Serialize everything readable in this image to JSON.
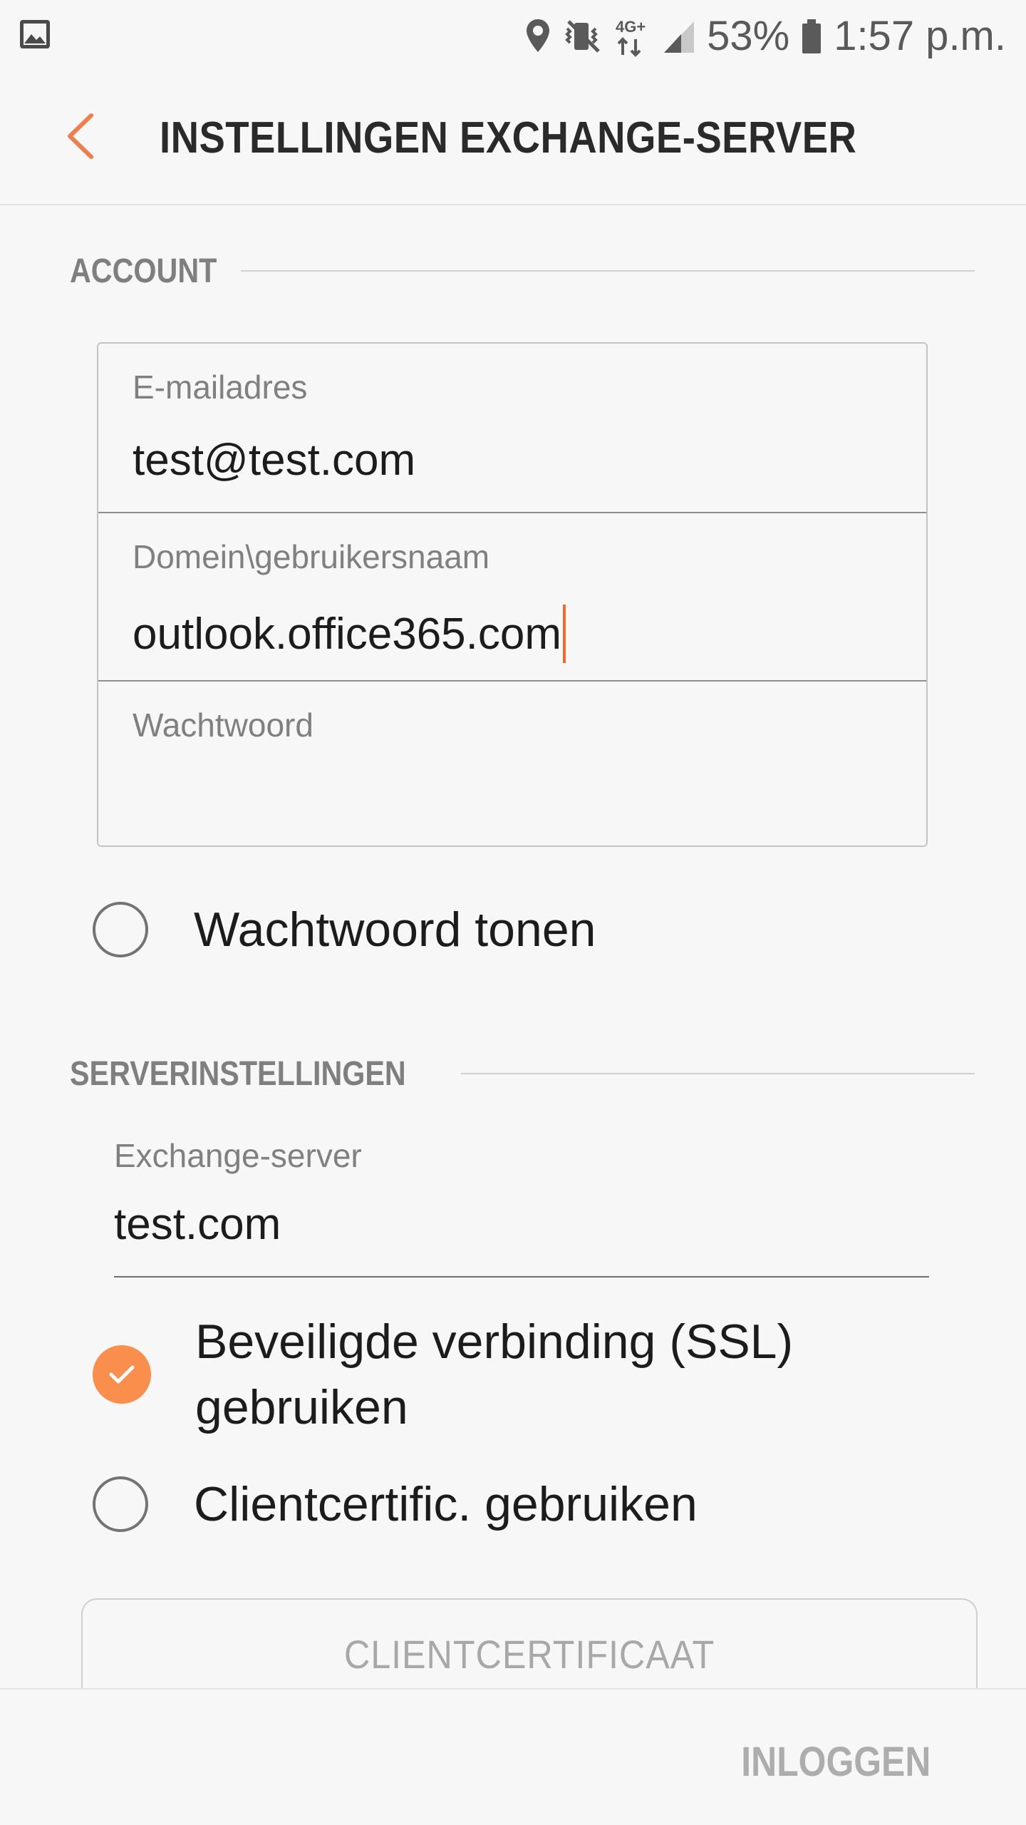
{
  "status_bar": {
    "battery_percent": "53%",
    "time": "1:57 p.m.",
    "network_label": "4G+",
    "icons": [
      "gallery-icon",
      "location-icon",
      "vibrate-mute-icon",
      "signal-icon",
      "battery-icon"
    ]
  },
  "app_bar": {
    "title": "INSTELLINGEN EXCHANGE-SERVER",
    "back_icon": "chevron-left-icon"
  },
  "account": {
    "section_title": "ACCOUNT",
    "email": {
      "label": "E-mailadres",
      "value": "test@test.com"
    },
    "domain_user": {
      "label": "Domein\\gebruikersnaam",
      "value": "outlook.office365.com"
    },
    "password": {
      "label": "Wachtwoord",
      "value": ""
    },
    "show_password": {
      "label": "Wachtwoord tonen",
      "checked": false
    }
  },
  "server": {
    "section_title": "SERVERINSTELLINGEN",
    "exchange_server": {
      "label": "Exchange-server",
      "value": "test.com"
    },
    "use_ssl": {
      "label": "Beveiligde verbinding (SSL) gebruiken",
      "checked": true
    },
    "use_client_cert": {
      "label": "Clientcertific. gebruiken",
      "checked": false
    },
    "client_cert_button": "CLIENTCERTIFICAAT"
  },
  "footer": {
    "login_button": "INLOGGEN"
  },
  "colors": {
    "accent": "#f98e4d",
    "caret": "#f06a2c",
    "background": "#f7f7f7",
    "disabled_text": "#adadad"
  }
}
